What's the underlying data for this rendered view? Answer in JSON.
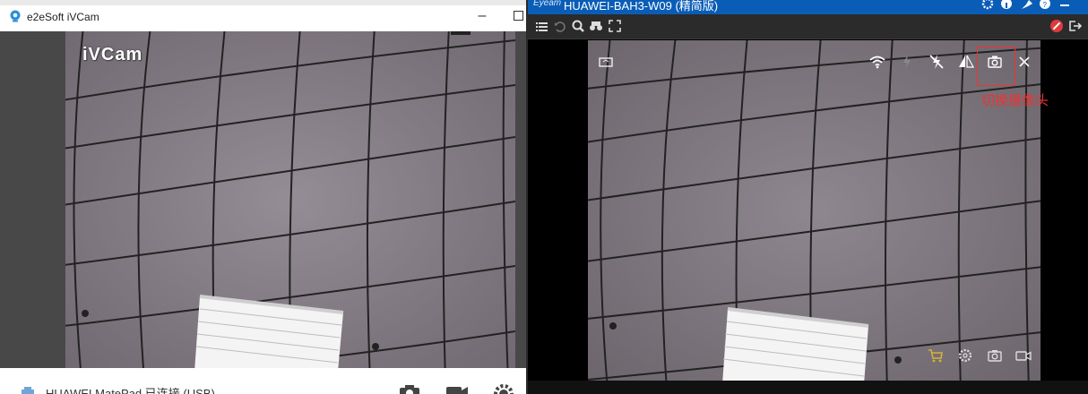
{
  "left_window": {
    "title": "e2eSoft iVCam",
    "watermark": "iVCam",
    "device_status": "HUAWEI MatePad 已连接 (USB)",
    "icons": [
      "camera-icon",
      "video-icon",
      "settings-icon",
      "usb-icon"
    ]
  },
  "right_window": {
    "logo": "Eyeam",
    "title": "HUAWEI-BAH3-W09 (精简版)",
    "annotation": "切换摄像头",
    "titlebar_icons": [
      "gear-icon",
      "info-icon",
      "pin-icon",
      "help-icon",
      "minimize-icon"
    ],
    "toolbar_icons": [
      "list-icon",
      "undo-icon",
      "zoom-icon",
      "binoculars-icon",
      "fullscreen-icon",
      "record-disabled-icon",
      "exit-icon"
    ],
    "overlay_icons": [
      "rotate-icon",
      "wifi-icon",
      "flash-icon",
      "flash-off-icon",
      "mirror-icon",
      "switch-camera-icon",
      "close-icon",
      "cart-icon",
      "settings-icon",
      "snapshot-icon",
      "video-record-icon"
    ]
  },
  "colors": {
    "titlebar_blue": "#0a5db7",
    "annotation_red": "#e33333",
    "ceiling": "#8d848c"
  }
}
